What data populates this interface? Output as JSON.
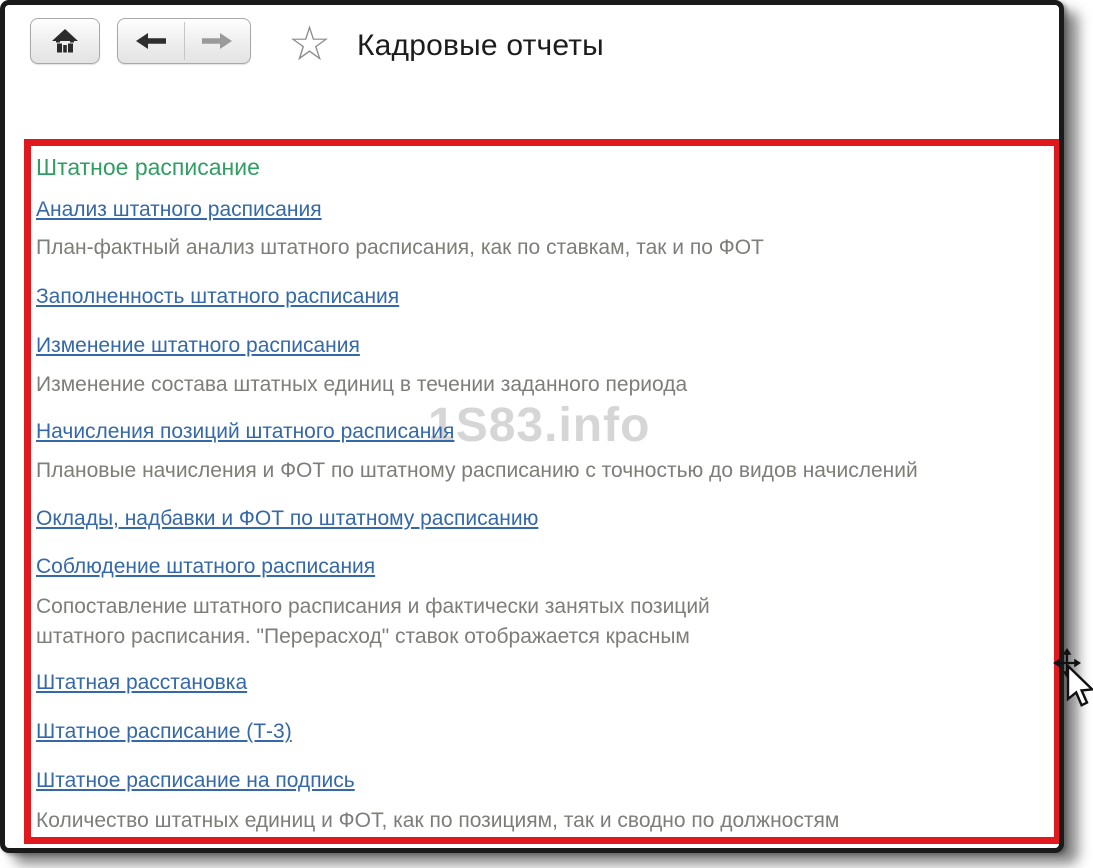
{
  "header": {
    "title": "Кадровые отчеты"
  },
  "toolbar": {
    "home_icon": "home-icon",
    "back_icon": "arrow-left-icon",
    "forward_icon": "arrow-right-icon",
    "favorite_icon": "star-outline-icon",
    "star_glyph": "☆"
  },
  "section": {
    "heading": "Штатное расписание",
    "items": [
      {
        "label": "Анализ штатного расписания",
        "desc": "План-фактный анализ штатного расписания, как по ставкам, так и по ФОТ"
      },
      {
        "label": "Заполненность штатного расписания"
      },
      {
        "label": "Изменение штатного расписания",
        "desc": "Изменение состава штатных единиц в течении заданного периода"
      },
      {
        "label": "Начисления позиций штатного расписания",
        "desc": "Плановые начисления и ФОТ по штатному расписанию с точностью до видов начислений"
      },
      {
        "label": "Оклады, надбавки и ФОТ по штатному расписанию"
      },
      {
        "label": "Соблюдение штатного расписания",
        "desc1": "Сопоставление штатного расписания и фактически занятых позиций",
        "desc2": "штатного расписания. \"Перерасход\" ставок отображается красным"
      },
      {
        "label": "Штатная расстановка"
      },
      {
        "label": "Штатное расписание (Т-3)"
      },
      {
        "label": "Штатное расписание на подпись",
        "desc": "Количество штатных единиц и ФОТ, как по позициям, так и сводно по должностям"
      }
    ]
  },
  "watermark": "1S83.info",
  "colors": {
    "highlight_border": "#e1181e",
    "heading_green": "#2f9e62",
    "link_blue": "#3568a8",
    "desc_gray": "#7f7d79",
    "frame_black": "#1a1a1a"
  }
}
